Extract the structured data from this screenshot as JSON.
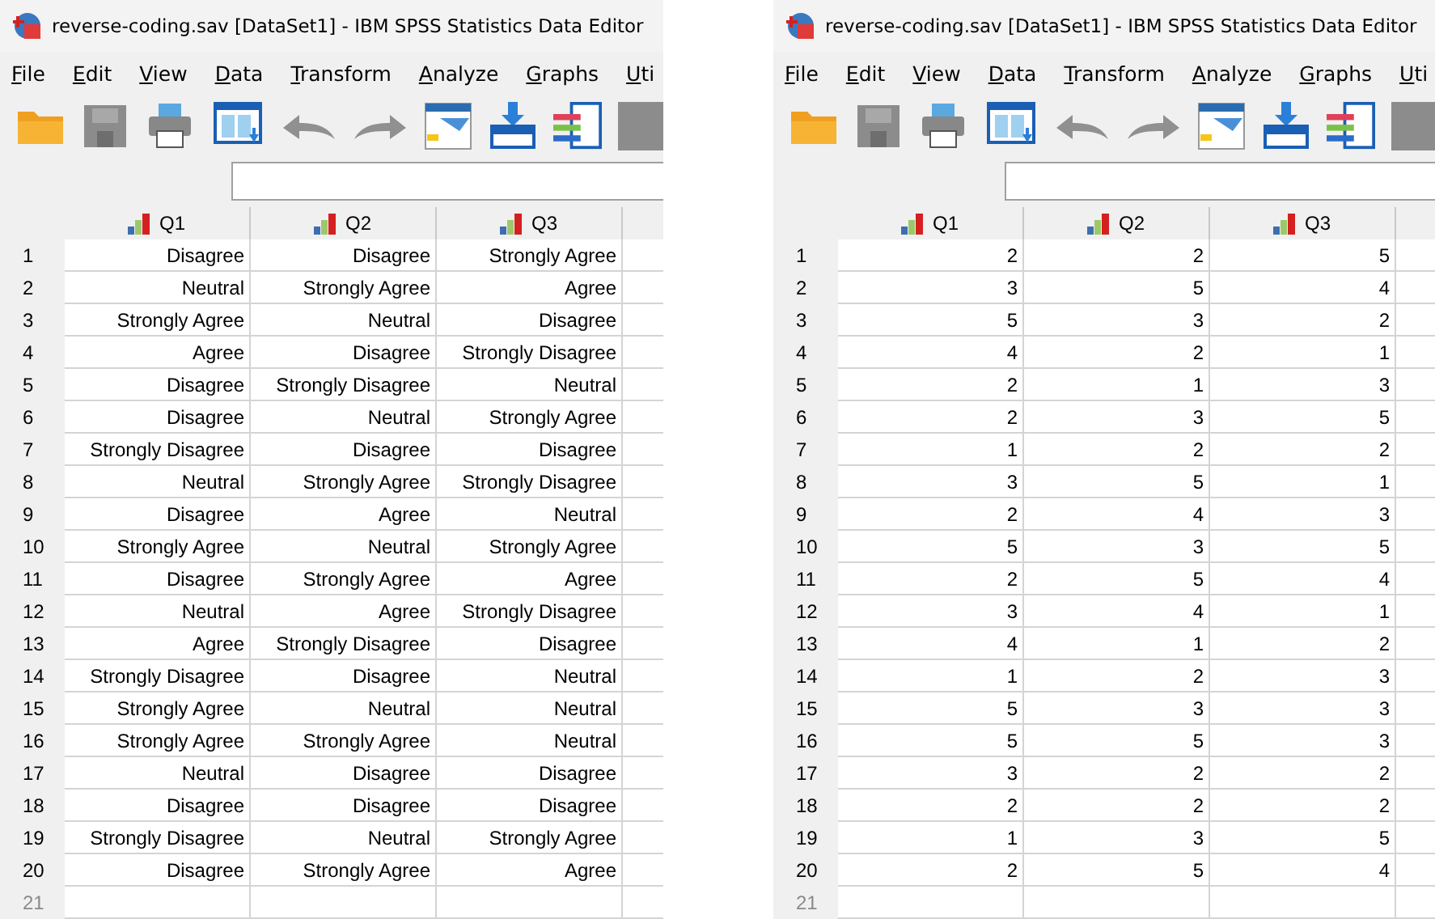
{
  "windows": [
    {
      "title": "reverse-coding.sav [DataSet1] - IBM SPSS Statistics Data Editor",
      "menu": [
        "File",
        "Edit",
        "View",
        "Data",
        "Transform",
        "Analyze",
        "Graphs",
        "Uti"
      ],
      "columns": [
        "Q1",
        "Q2",
        "Q3"
      ],
      "new_row_number": "21",
      "rows": [
        {
          "number": "1",
          "cells": [
            "Disagree",
            "Disagree",
            "Strongly Agree"
          ]
        },
        {
          "number": "2",
          "cells": [
            "Neutral",
            "Strongly Agree",
            "Agree"
          ]
        },
        {
          "number": "3",
          "cells": [
            "Strongly Agree",
            "Neutral",
            "Disagree"
          ]
        },
        {
          "number": "4",
          "cells": [
            "Agree",
            "Disagree",
            "Strongly Disagree"
          ]
        },
        {
          "number": "5",
          "cells": [
            "Disagree",
            "Strongly Disagree",
            "Neutral"
          ]
        },
        {
          "number": "6",
          "cells": [
            "Disagree",
            "Neutral",
            "Strongly Agree"
          ]
        },
        {
          "number": "7",
          "cells": [
            "Strongly Disagree",
            "Disagree",
            "Disagree"
          ]
        },
        {
          "number": "8",
          "cells": [
            "Neutral",
            "Strongly Agree",
            "Strongly Disagree"
          ]
        },
        {
          "number": "9",
          "cells": [
            "Disagree",
            "Agree",
            "Neutral"
          ]
        },
        {
          "number": "10",
          "cells": [
            "Strongly Agree",
            "Neutral",
            "Strongly Agree"
          ]
        },
        {
          "number": "11",
          "cells": [
            "Disagree",
            "Strongly Agree",
            "Agree"
          ]
        },
        {
          "number": "12",
          "cells": [
            "Neutral",
            "Agree",
            "Strongly Disagree"
          ]
        },
        {
          "number": "13",
          "cells": [
            "Agree",
            "Strongly Disagree",
            "Disagree"
          ]
        },
        {
          "number": "14",
          "cells": [
            "Strongly Disagree",
            "Disagree",
            "Neutral"
          ]
        },
        {
          "number": "15",
          "cells": [
            "Strongly Agree",
            "Neutral",
            "Neutral"
          ]
        },
        {
          "number": "16",
          "cells": [
            "Strongly Agree",
            "Strongly Agree",
            "Neutral"
          ]
        },
        {
          "number": "17",
          "cells": [
            "Neutral",
            "Disagree",
            "Disagree"
          ]
        },
        {
          "number": "18",
          "cells": [
            "Disagree",
            "Disagree",
            "Disagree"
          ]
        },
        {
          "number": "19",
          "cells": [
            "Strongly Disagree",
            "Neutral",
            "Strongly Agree"
          ]
        },
        {
          "number": "20",
          "cells": [
            "Disagree",
            "Strongly Agree",
            "Agree"
          ]
        }
      ]
    },
    {
      "title": "reverse-coding.sav [DataSet1] - IBM SPSS Statistics Data Editor",
      "menu": [
        "File",
        "Edit",
        "View",
        "Data",
        "Transform",
        "Analyze",
        "Graphs",
        "Uti"
      ],
      "columns": [
        "Q1",
        "Q2",
        "Q3"
      ],
      "new_row_number": "21",
      "rows": [
        {
          "number": "1",
          "cells": [
            "2",
            "2",
            "5"
          ]
        },
        {
          "number": "2",
          "cells": [
            "3",
            "5",
            "4"
          ]
        },
        {
          "number": "3",
          "cells": [
            "5",
            "3",
            "2"
          ]
        },
        {
          "number": "4",
          "cells": [
            "4",
            "2",
            "1"
          ]
        },
        {
          "number": "5",
          "cells": [
            "2",
            "1",
            "3"
          ]
        },
        {
          "number": "6",
          "cells": [
            "2",
            "3",
            "5"
          ]
        },
        {
          "number": "7",
          "cells": [
            "1",
            "2",
            "2"
          ]
        },
        {
          "number": "8",
          "cells": [
            "3",
            "5",
            "1"
          ]
        },
        {
          "number": "9",
          "cells": [
            "2",
            "4",
            "3"
          ]
        },
        {
          "number": "10",
          "cells": [
            "5",
            "3",
            "5"
          ]
        },
        {
          "number": "11",
          "cells": [
            "2",
            "5",
            "4"
          ]
        },
        {
          "number": "12",
          "cells": [
            "3",
            "4",
            "1"
          ]
        },
        {
          "number": "13",
          "cells": [
            "4",
            "1",
            "2"
          ]
        },
        {
          "number": "14",
          "cells": [
            "1",
            "2",
            "3"
          ]
        },
        {
          "number": "15",
          "cells": [
            "5",
            "3",
            "3"
          ]
        },
        {
          "number": "16",
          "cells": [
            "5",
            "5",
            "3"
          ]
        },
        {
          "number": "17",
          "cells": [
            "3",
            "2",
            "2"
          ]
        },
        {
          "number": "18",
          "cells": [
            "2",
            "2",
            "2"
          ]
        },
        {
          "number": "19",
          "cells": [
            "1",
            "3",
            "5"
          ]
        },
        {
          "number": "20",
          "cells": [
            "2",
            "5",
            "4"
          ]
        }
      ]
    }
  ]
}
